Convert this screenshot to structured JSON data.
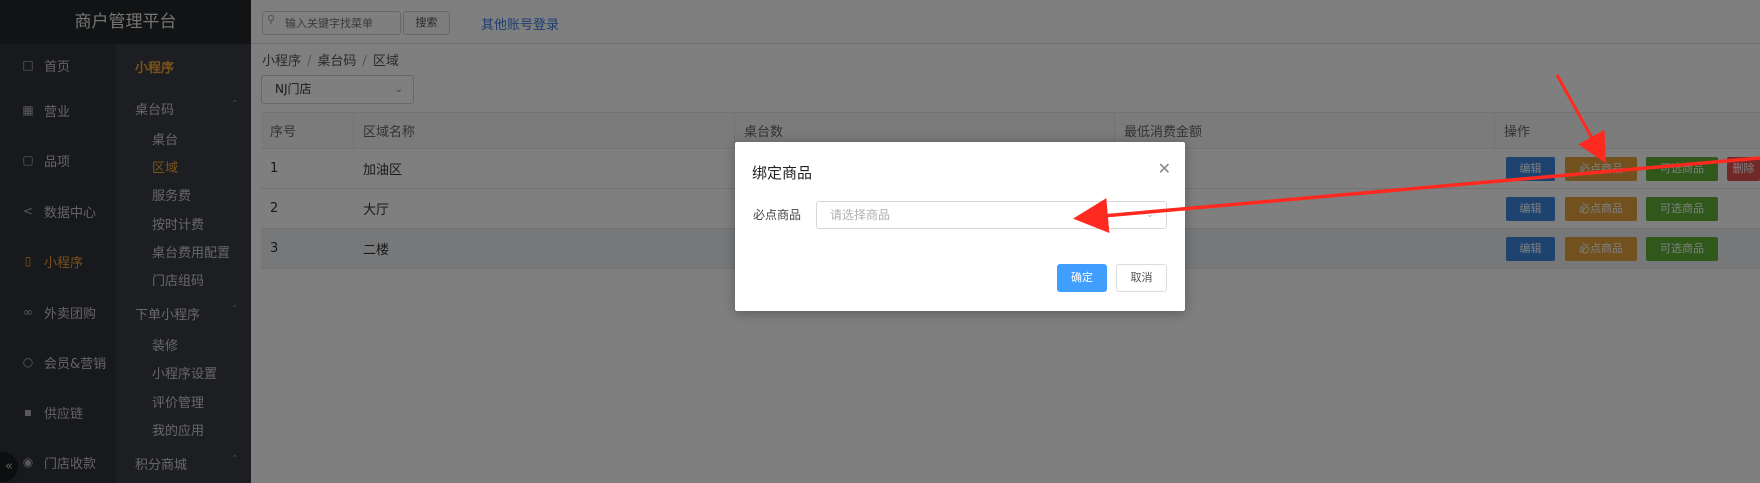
{
  "brand": "商户管理平台",
  "nav": {
    "items": [
      {
        "label": "首页",
        "icon": "file-icon"
      },
      {
        "label": "营业",
        "icon": "calendar-icon"
      },
      {
        "label": "品项",
        "icon": "bag-icon"
      },
      {
        "label": "数据中心",
        "icon": "share-icon"
      },
      {
        "label": "小程序",
        "icon": "mobile-icon"
      },
      {
        "label": "外卖团购",
        "icon": "bike-icon"
      },
      {
        "label": "会员&营销",
        "icon": "user-icon"
      },
      {
        "label": "供应链",
        "icon": "truck-icon"
      },
      {
        "label": "门店收款",
        "icon": "database-icon"
      }
    ],
    "sub_title": "小程序",
    "groups": [
      {
        "label": "桌台码",
        "items": [
          "桌台",
          "区域",
          "服务费",
          "按时计费",
          "桌台费用配置",
          "门店组码"
        ]
      },
      {
        "label": "下单小程序",
        "items": [
          "装修",
          "小程序设置",
          "评价管理",
          "我的应用"
        ]
      },
      {
        "label": "积分商城",
        "items": []
      }
    ]
  },
  "topbar": {
    "search_placeholder": "输入关键字找菜单",
    "search_button": "搜索",
    "other_login": "其他账号登录"
  },
  "breadcrumb": [
    "小程序",
    "桌台码",
    "区域"
  ],
  "store_select": "NJ门店",
  "table": {
    "columns": [
      "序号",
      "区域名称",
      "桌台数",
      "最低消费金额",
      "操作"
    ],
    "rows": [
      {
        "no": "1",
        "name": "加油区"
      },
      {
        "no": "2",
        "name": "大厅"
      },
      {
        "no": "3",
        "name": "二楼"
      }
    ],
    "actions": {
      "edit": "编辑",
      "must": "必点商品",
      "optional": "可选商品",
      "delete": "删除"
    }
  },
  "dialog": {
    "title": "绑定商品",
    "label": "必点商品",
    "placeholder": "请选择商品",
    "ok": "确定",
    "cancel": "取消"
  },
  "colors": {
    "accent_orange": "#f0a43a",
    "primary_blue": "#409eff",
    "arrow_red": "#ff2a1f"
  }
}
